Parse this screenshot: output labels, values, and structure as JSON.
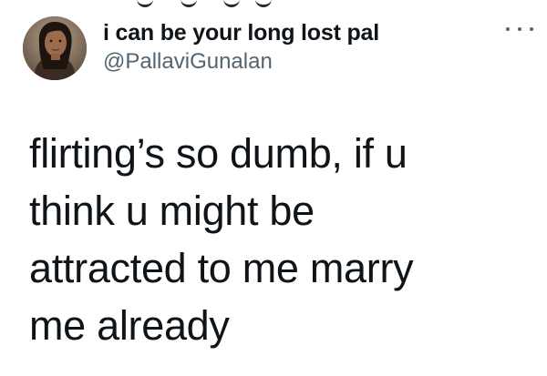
{
  "tweet": {
    "author": {
      "display_name": "i can be your long lost pal",
      "handle": "@PallaviGunalan",
      "avatar_icon": "profile-photo"
    },
    "more_icon": "more-options-icon",
    "text": "flirting’s so dumb, if u\nthink u might be\nattracted to me marry\nme already"
  },
  "colors": {
    "text": "#0f1419",
    "secondary": "#536471",
    "background": "#ffffff"
  }
}
